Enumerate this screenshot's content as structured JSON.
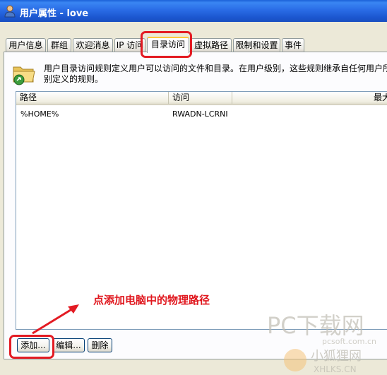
{
  "window": {
    "title": "用户属性 - love"
  },
  "tabs": [
    {
      "label": "用户信息"
    },
    {
      "label": "群组"
    },
    {
      "label": "欢迎消息"
    },
    {
      "label": "IP 访问"
    },
    {
      "label": "目录访问"
    },
    {
      "label": "虚拟路径"
    },
    {
      "label": "限制和设置"
    },
    {
      "label": "事件"
    }
  ],
  "active_tab": "目录访问",
  "description": {
    "line1": "用户目录访问规则定义用户可以访问的文件和目录。在用户级别，这些规则继承自任何用户所",
    "line2": "别定义的规则。"
  },
  "listview": {
    "columns": [
      {
        "label": "路径"
      },
      {
        "label": "访问"
      },
      {
        "label": "最大"
      }
    ],
    "rows": [
      {
        "path": "%HOME%",
        "access": "RWADN-LCRNI"
      }
    ]
  },
  "annotation": {
    "text": "点添加电脑中的物理路径"
  },
  "buttons": {
    "add": "添加...",
    "edit": "编辑...",
    "delete": "删除"
  },
  "watermark": {
    "brand": "PC下载网",
    "site": "pcsoft.com.cn",
    "partner": "小狐狸网",
    "partner_site": "XHLKS.CN"
  },
  "colors": {
    "titlebar": "#2a6ce6",
    "highlight_box": "#e31b23",
    "annotation": "#e0161d",
    "active_tab_accent": "#ffc83c"
  }
}
